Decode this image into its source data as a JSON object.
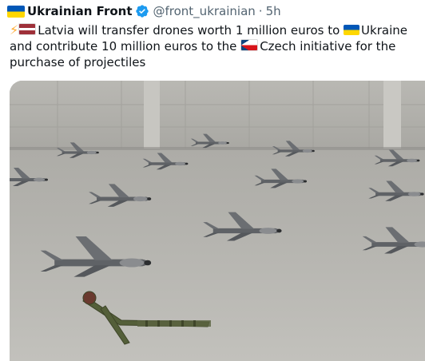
{
  "tweet": {
    "author_name": "Ukrainian Front",
    "handle": "@front_ukrainian",
    "separator": "·",
    "time": "5h",
    "text_part1": "Latvia will transfer drones worth 1 million euros to ",
    "text_part2": "Ukraine and contribute 10 million euros to the ",
    "text_part3": "Czech initiative for the purchase of projectiles"
  },
  "icons": {
    "verified": "verified-badge-icon",
    "bolt": "high-voltage-emoji",
    "flag_author": "ukraine-flag-emoji",
    "flag_latvia": "latvia-flag-emoji",
    "flag_ukraine": "ukraine-flag-emoji",
    "flag_czech": "czech-flag-emoji"
  },
  "colors": {
    "text": "#0f1419",
    "secondary": "#536471",
    "verified": "#1d9bf0"
  },
  "media": {
    "type": "photo"
  }
}
